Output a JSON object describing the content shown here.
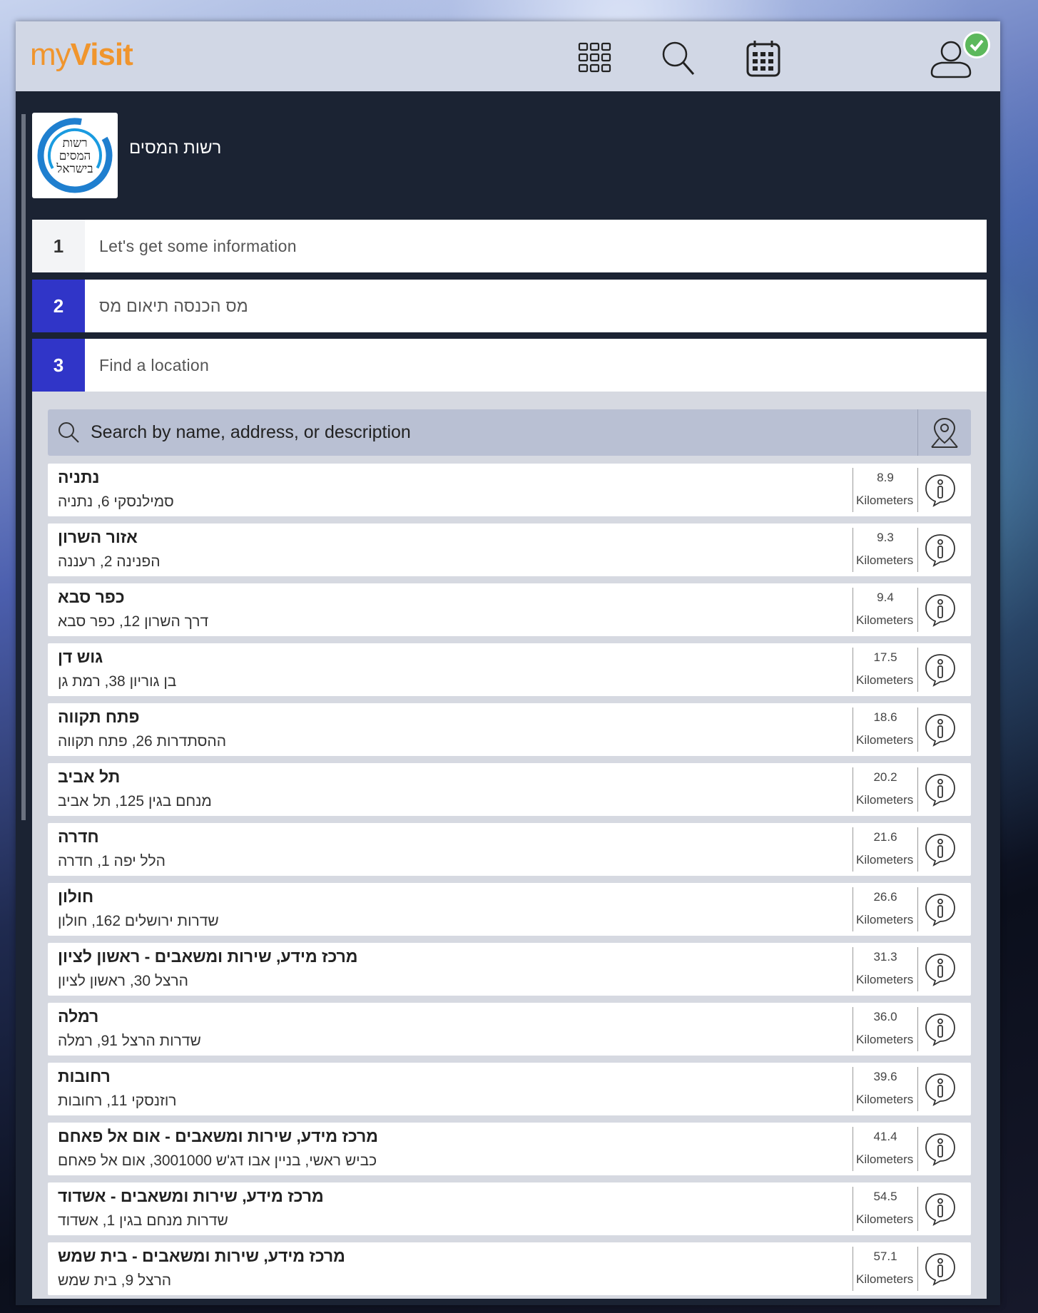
{
  "app": {
    "logo_my": "my",
    "logo_visit": "Visit",
    "brand_color": "#f0952d"
  },
  "topbar": {
    "icons": [
      "apps-grid-icon",
      "search-icon",
      "calendar-icon",
      "user-icon"
    ],
    "status_color": "#5cb85c"
  },
  "organization": {
    "name": "רשות המסים",
    "logo_text_line1": "רשות",
    "logo_text_line2": "המסים",
    "logo_text_line3": "בישראל"
  },
  "steps": [
    {
      "number": "1",
      "label": "Let's get some information",
      "state": "done"
    },
    {
      "number": "2",
      "label": "מס הכנסה תיאום מס",
      "state": "active"
    },
    {
      "number": "3",
      "label": "Find a location",
      "state": "active"
    }
  ],
  "search": {
    "placeholder": "Search by name, address, or description"
  },
  "locations": [
    {
      "name": "נתניה",
      "address": "סמילנסקי 6, נתניה",
      "distance": "8.9",
      "unit": "Kilometers"
    },
    {
      "name": "אזור השרון",
      "address": "הפנינה 2, רעננה",
      "distance": "9.3",
      "unit": "Kilometers"
    },
    {
      "name": "כפר סבא",
      "address": "דרך השרון 12, כפר סבא",
      "distance": "9.4",
      "unit": "Kilometers"
    },
    {
      "name": "גוש דן",
      "address": "בן גוריון 38, רמת גן",
      "distance": "17.5",
      "unit": "Kilometers"
    },
    {
      "name": "פתח תקווה",
      "address": "ההסתדרות 26, פתח תקווה",
      "distance": "18.6",
      "unit": "Kilometers"
    },
    {
      "name": "תל אביב",
      "address": "מנחם בגין 125, תל אביב",
      "distance": "20.2",
      "unit": "Kilometers"
    },
    {
      "name": "חדרה",
      "address": "הלל יפה 1, חדרה",
      "distance": "21.6",
      "unit": "Kilometers"
    },
    {
      "name": "חולון",
      "address": "שדרות ירושלים 162, חולון",
      "distance": "26.6",
      "unit": "Kilometers"
    },
    {
      "name": "מרכז מידע, שירות ומשאבים - ראשון לציון",
      "address": "הרצל 30, ראשון לציון",
      "distance": "31.3",
      "unit": "Kilometers"
    },
    {
      "name": "רמלה",
      "address": "שדרות הרצל 91, רמלה",
      "distance": "36.0",
      "unit": "Kilometers"
    },
    {
      "name": "רחובות",
      "address": "רוזנסקי 11, רחובות",
      "distance": "39.6",
      "unit": "Kilometers"
    },
    {
      "name": "מרכז מידע, שירות ומשאבים - אום אל פאחם",
      "address": "כביש ראשי, בניין אבו דג'ש 3001000, אום אל פאחם",
      "distance": "41.4",
      "unit": "Kilometers"
    },
    {
      "name": "מרכז מידע, שירות ומשאבים - אשדוד",
      "address": "שדרות מנחם בגין 1, אשדוד",
      "distance": "54.5",
      "unit": "Kilometers"
    },
    {
      "name": "מרכז מידע, שירות ומשאבים - בית שמש",
      "address": "הרצל 9, בית שמש",
      "distance": "57.1",
      "unit": "Kilometers"
    }
  ]
}
